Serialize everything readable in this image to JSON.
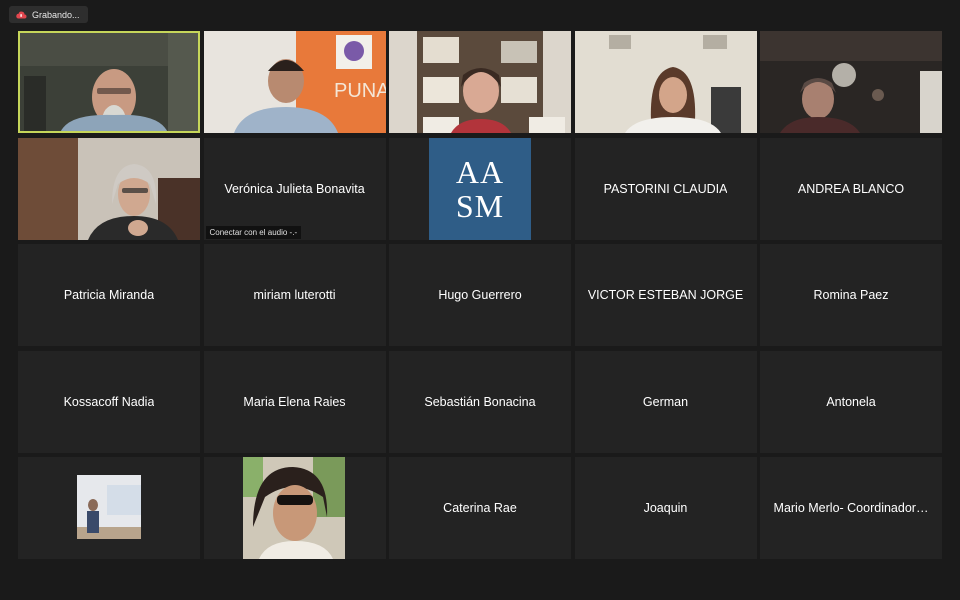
{
  "recording": {
    "label": "Grabando..."
  },
  "participants": [
    {
      "name": "",
      "type": "video"
    },
    {
      "name": "",
      "type": "video"
    },
    {
      "name": "",
      "type": "video"
    },
    {
      "name": "",
      "type": "video"
    },
    {
      "name": "",
      "type": "video"
    },
    {
      "name": "",
      "type": "video"
    },
    {
      "name": "Verónica Julieta Bonavita",
      "type": "name",
      "audio_status": "Conectar con el audio -.-"
    },
    {
      "name": "",
      "type": "logo",
      "logo_text": [
        "AA",
        "SM"
      ],
      "logo_color": "#2f5d87"
    },
    {
      "name": "PASTORINI CLAUDIA",
      "type": "name"
    },
    {
      "name": "ANDREA BLANCO",
      "type": "name"
    },
    {
      "name": "Patricia Miranda",
      "type": "name"
    },
    {
      "name": "miriam luterotti",
      "type": "name"
    },
    {
      "name": "Hugo Guerrero",
      "type": "name"
    },
    {
      "name": "VICTOR ESTEBAN JORGE",
      "type": "name"
    },
    {
      "name": "Romina Paez",
      "type": "name"
    },
    {
      "name": "Kossacoff Nadia",
      "type": "name"
    },
    {
      "name": "Maria Elena Raies",
      "type": "name"
    },
    {
      "name": "Sebastián Bonacina",
      "type": "name"
    },
    {
      "name": "German",
      "type": "name"
    },
    {
      "name": "Antonela",
      "type": "name"
    },
    {
      "name": "",
      "type": "profile-photo"
    },
    {
      "name": "",
      "type": "profile-photo"
    },
    {
      "name": "Caterina Rae",
      "type": "name"
    },
    {
      "name": "Joaquin",
      "type": "name"
    },
    {
      "name": "Mario Merlo- Coordinador…",
      "type": "name"
    }
  ],
  "colors": {
    "active_speaker_border": "#c6d65a",
    "tile_bg": "#232323",
    "page_bg": "#1a1a1a"
  }
}
